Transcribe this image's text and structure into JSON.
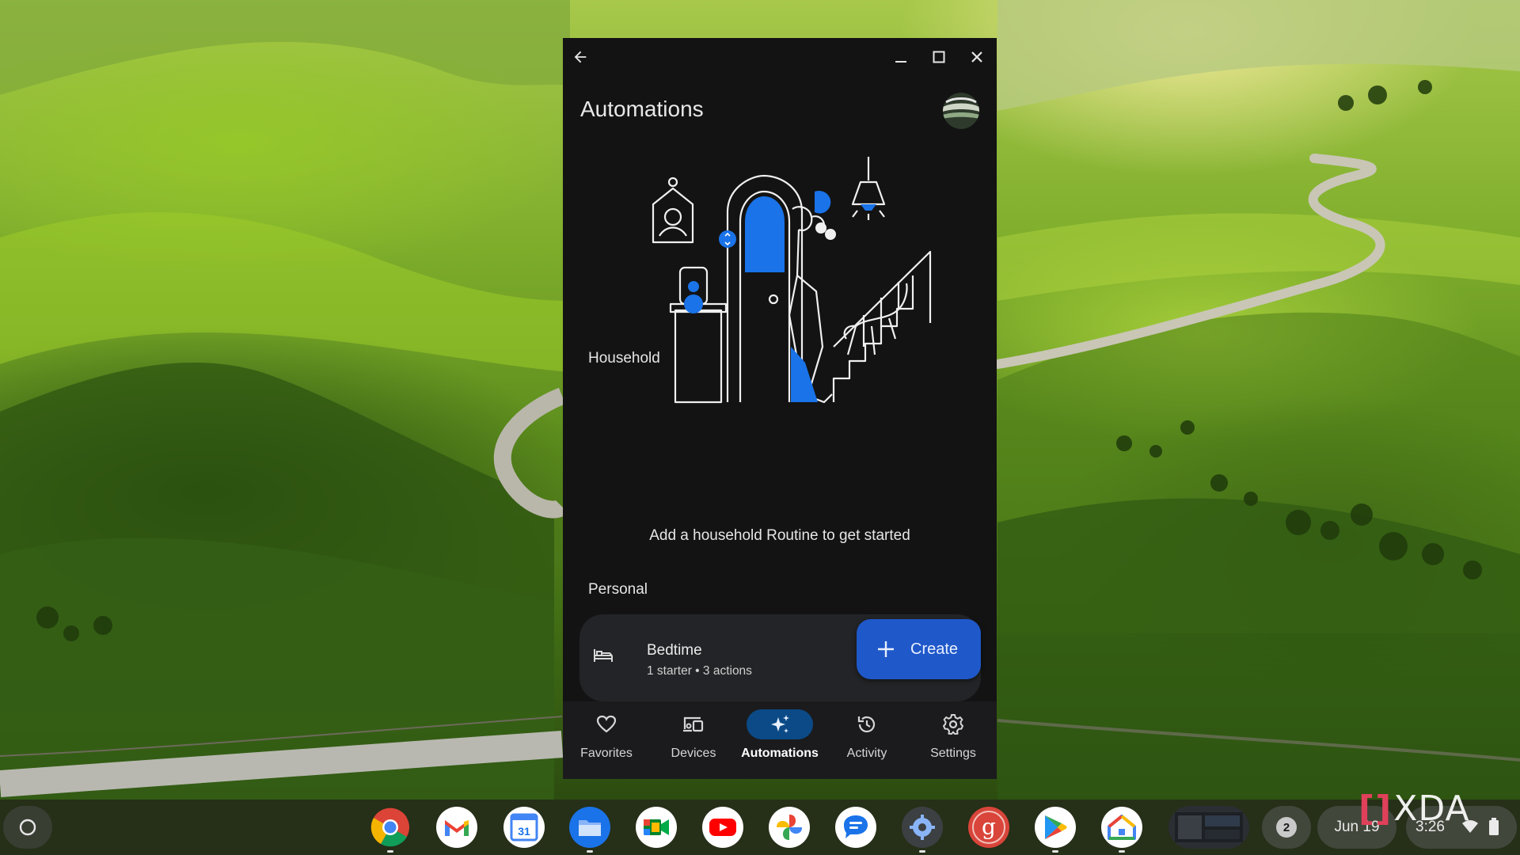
{
  "window": {
    "page_title": "Automations",
    "back_icon": "arrow-back-icon",
    "minimize_icon": "minimize-icon",
    "maximize_icon": "maximize-icon",
    "close_icon": "close-icon"
  },
  "sections": {
    "household": {
      "heading": "Household",
      "empty_message": "Add a household Routine to get started"
    },
    "personal": {
      "heading": "Personal",
      "routines": [
        {
          "name": "Bedtime",
          "meta": "1 starter • 3 actions",
          "icon": "bed-icon"
        }
      ]
    }
  },
  "fab": {
    "label": "Create",
    "icon": "plus-icon"
  },
  "bottom_nav": {
    "items": [
      {
        "label": "Favorites",
        "icon": "heart-icon",
        "active": false
      },
      {
        "label": "Devices",
        "icon": "devices-icon",
        "active": false
      },
      {
        "label": "Automations",
        "icon": "sparkle-icon",
        "active": true
      },
      {
        "label": "Activity",
        "icon": "history-icon",
        "active": false
      },
      {
        "label": "Settings",
        "icon": "gear-icon",
        "active": false
      }
    ]
  },
  "shelf": {
    "apps": [
      {
        "name": "Chrome",
        "icon": "chrome-icon"
      },
      {
        "name": "Gmail",
        "icon": "gmail-icon"
      },
      {
        "name": "Calendar",
        "icon": "calendar-icon",
        "badge": "31"
      },
      {
        "name": "Files",
        "icon": "files-icon"
      },
      {
        "name": "Meet",
        "icon": "meet-icon"
      },
      {
        "name": "YouTube",
        "icon": "youtube-icon"
      },
      {
        "name": "Photos",
        "icon": "photos-icon"
      },
      {
        "name": "Messages",
        "icon": "messages-icon"
      },
      {
        "name": "Settings",
        "icon": "settings-app-icon"
      },
      {
        "name": "Grammar",
        "icon": "g-app-icon",
        "letter": "g"
      },
      {
        "name": "Play Store",
        "icon": "play-store-icon"
      },
      {
        "name": "Google Home",
        "icon": "google-home-icon"
      }
    ],
    "notification_count": "2",
    "date": "Jun 19",
    "time": "3:26"
  },
  "watermark": {
    "text": "XDA"
  },
  "colors": {
    "window_bg": "#131314",
    "fab_bg": "#1f58c9",
    "nav_active_bg": "#0b4a86",
    "card_bg": "#232427"
  }
}
